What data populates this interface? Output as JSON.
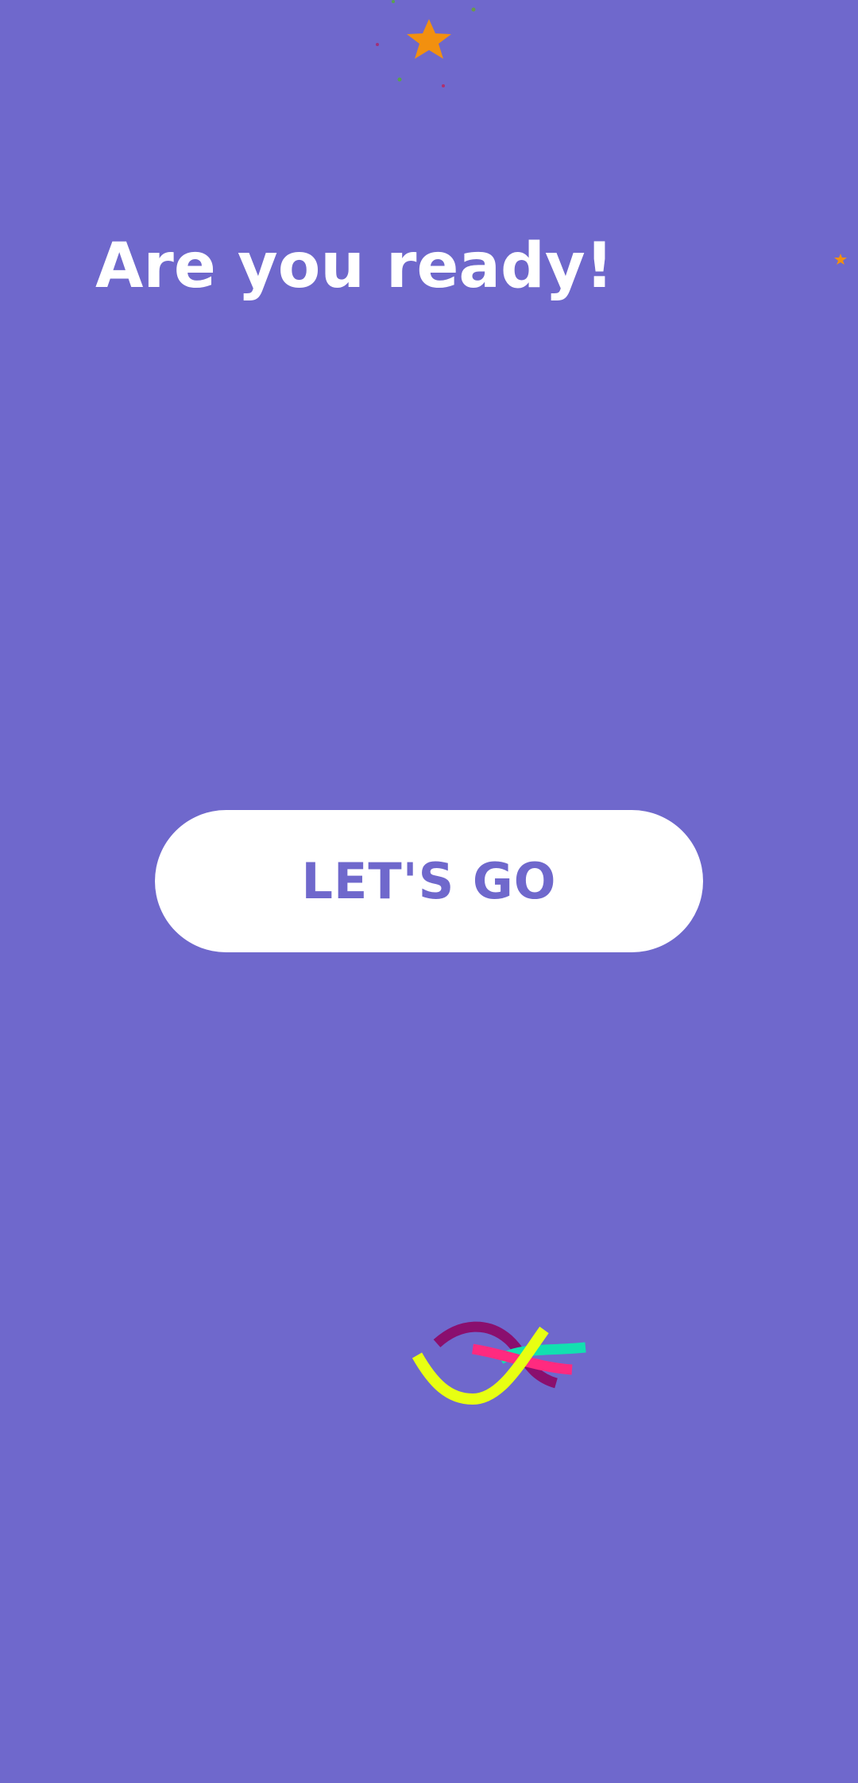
{
  "screen": {
    "title": "Are you ready!",
    "button_label": "LET'S GO"
  },
  "colors": {
    "background": "#6f68cc",
    "button_background": "#ffffff",
    "button_text": "#6f68cc",
    "title_text": "#ffffff",
    "star": "#f2900f",
    "logo_strands": [
      "#8a0f6e",
      "#e8ff12",
      "#ff2a7f",
      "#12e0b0"
    ]
  },
  "icons": {
    "confetti": "star-confetti-icon",
    "logo": "twisted-ribbons-logo-icon"
  }
}
